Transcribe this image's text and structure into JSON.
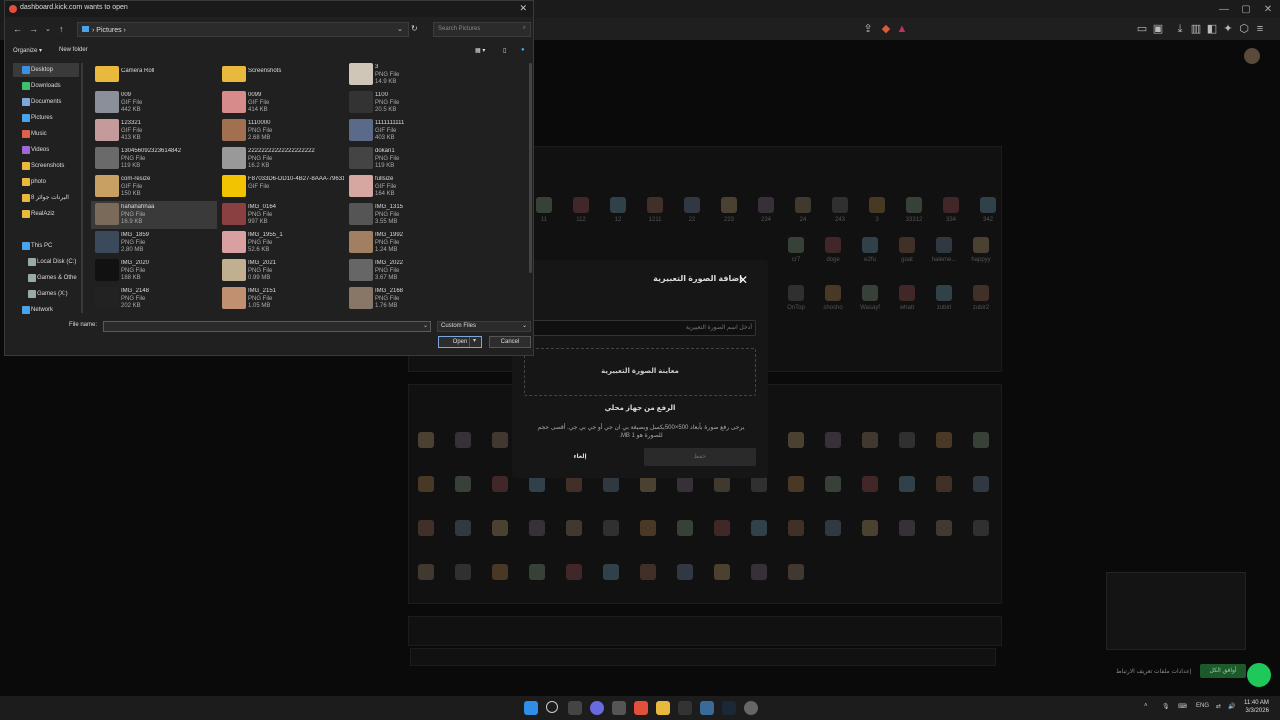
{
  "browser": {
    "window_controls": [
      "—",
      "▢",
      "✕"
    ]
  },
  "modal": {
    "title": "إضافة الصورة التعبيرية",
    "close": "✕",
    "name_placeholder": "أدخل اسم الصورة التعبيرية",
    "preview_label": "معاينة الصورة التعبيرية",
    "upload_label": "الرفع من جهاز محلي",
    "help_text": "يرجى رفع صورة بأبعاد 500×500بكسل وبصيغة بي ان جي أو جي بي جي. أقصى حجم للصورة هو 1 MB.",
    "cancel_label": "إلغاء",
    "save_label": "حفظ"
  },
  "emote_labels_row1": [
    "11",
    "112",
    "12",
    "1211",
    "22",
    "223",
    "234",
    "24",
    "243",
    "3",
    "33312",
    "334",
    "342"
  ],
  "emote_labels_row2": [
    "cr7",
    "doge",
    "e2fu",
    "goat",
    "haleme...",
    "happyy"
  ],
  "emote_labels_row3": [
    "OnTop",
    "shosho",
    "Wasayf",
    "whatt",
    "zubirl",
    "zubir2"
  ],
  "bottom_link": "إعدادات ملفات تعريف الارتباط",
  "bottom_button": "أوافق الكل",
  "dialog": {
    "title": "dashboard.kick.com wants to open",
    "close": "✕",
    "address": "Pictures",
    "address_sep": "›",
    "search_placeholder": "Search Pictures",
    "organize": "Organize ▾",
    "new_folder": "New folder",
    "sidebar": [
      {
        "label": "Desktop",
        "color": "#3d8fe0",
        "selected": true
      },
      {
        "label": "Downloads",
        "color": "#3dbf6e"
      },
      {
        "label": "Documents",
        "color": "#7fa7d9"
      },
      {
        "label": "Pictures",
        "color": "#4aa3e8"
      },
      {
        "label": "Music",
        "color": "#e0604a"
      },
      {
        "label": "Videos",
        "color": "#9b6ad6"
      },
      {
        "label": "Screenshots",
        "color": "#e8b93c"
      },
      {
        "label": "photo",
        "color": "#e8b93c"
      },
      {
        "label": "البرنات جوائز 8",
        "color": "#e8b93c"
      },
      {
        "label": "RealAziz",
        "color": "#e8b93c"
      },
      {
        "label": "This PC",
        "color": "#4aa3e8"
      },
      {
        "label": "Local Disk (C:)",
        "color": "#9aa"
      },
      {
        "label": "Games & Othe",
        "color": "#9aa"
      },
      {
        "label": "Games (X:)",
        "color": "#9aa"
      },
      {
        "label": "Network",
        "color": "#4aa3e8"
      }
    ],
    "files": [
      {
        "name": "Camera Roll",
        "type": "",
        "size": "",
        "folder": true
      },
      {
        "name": "Screenshots",
        "type": "",
        "size": "",
        "folder": true
      },
      {
        "name": "3",
        "type": "PNG File",
        "size": "14.9 KB",
        "color": "#cfc6b8"
      },
      {
        "name": "009",
        "type": "GIF File",
        "size": "442 KB",
        "color": "#8a8f99"
      },
      {
        "name": "0099",
        "type": "GIF File",
        "size": "414 KB",
        "color": "#d88b8b"
      },
      {
        "name": "1100",
        "type": "PNG File",
        "size": "20.5 KB",
        "color": "#333"
      },
      {
        "name": "123321",
        "type": "GIF File",
        "size": "413 KB",
        "color": "#c49a9a"
      },
      {
        "name": "1110000",
        "type": "PNG File",
        "size": "2.68 MB",
        "color": "#a07050"
      },
      {
        "name": "1111111111",
        "type": "GIF File",
        "size": "403 KB",
        "color": "#5a6a88"
      },
      {
        "name": "13045609232361484​2",
        "type": "PNG File",
        "size": "119 KB",
        "color": "#6a6a6a"
      },
      {
        "name": "22222222222222222222",
        "type": "PNG File",
        "size": "16.2 KB",
        "color": "#999"
      },
      {
        "name": "dokan1",
        "type": "PNG File",
        "size": "119 KB",
        "color": "#444"
      },
      {
        "name": "com-resize",
        "type": "GIF File",
        "size": "150 KB",
        "color": "#c9a063"
      },
      {
        "name": "F87033D6-DD10-4B27-8AAA-79631371DF88",
        "type": "GIF File",
        "size": "",
        "color": "#f2c300"
      },
      {
        "name": "fullsize",
        "type": "GIF File",
        "size": "164 KB",
        "color": "#d6a7a0"
      },
      {
        "name": "hahahahhaa",
        "type": "PNG File",
        "size": "16.9 KB",
        "color": "#7a6a5a",
        "selected": true
      },
      {
        "name": "IMG_0164",
        "type": "PNG File",
        "size": "997 KB",
        "color": "#8a4040"
      },
      {
        "name": "IMG_1315",
        "type": "PNG File",
        "size": "3.55 MB",
        "color": "#555"
      },
      {
        "name": "IMG_1859",
        "type": "PNG File",
        "size": "2.80 MB",
        "color": "#3a4a5a"
      },
      {
        "name": "IMG_1955_1",
        "type": "PNG File",
        "size": "52.6 KB",
        "color": "#d8a0a0"
      },
      {
        "name": "IMG_1992",
        "type": "PNG File",
        "size": "1.24 MB",
        "color": "#a08060"
      },
      {
        "name": "IMG_2020",
        "type": "PNG File",
        "size": "188 KB",
        "color": "#111"
      },
      {
        "name": "IMG_2021",
        "type": "PNG File",
        "size": "0.99 MB",
        "color": "#c0b090"
      },
      {
        "name": "IMG_2022",
        "type": "PNG File",
        "size": "3.67 MB",
        "color": "#666"
      },
      {
        "name": "IMG_2148",
        "type": "PNG File",
        "size": "202 KB",
        "color": "#222"
      },
      {
        "name": "IMG_2151",
        "type": "PNG File",
        "size": "1.05 MB",
        "color": "#c09070"
      },
      {
        "name": "IMG_2168",
        "type": "PNG File",
        "size": "1.76 MB",
        "color": "#887766"
      }
    ],
    "file_name_label": "File name:",
    "file_name_value": "",
    "file_type": "Custom Files",
    "open_label": "Open",
    "cancel_label": "Cancel"
  },
  "taskbar": {
    "lang": "ENG",
    "time": "11:40 AM",
    "date": "3/3/2026"
  }
}
